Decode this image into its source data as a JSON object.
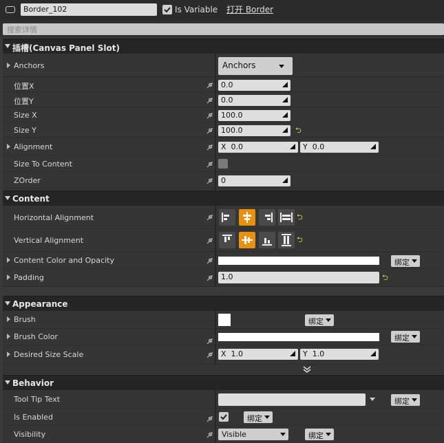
{
  "header": {
    "widget_name": "Border_102",
    "is_variable_label": "Is Variable",
    "is_variable_checked": true,
    "open_link": "打开 Border"
  },
  "search": {
    "placeholder": "搜索详情"
  },
  "sections": {
    "slot": "插槽(Canvas Panel Slot)",
    "content": "Content",
    "appearance": "Appearance",
    "behavior": "Behavior"
  },
  "slot": {
    "anchors_label": "Anchors",
    "anchors_value": "Anchors",
    "pos_x_label": "位置X",
    "pos_x_value": "0.0",
    "pos_y_label": "位置Y",
    "pos_y_value": "0.0",
    "size_x_label": "Size X",
    "size_x_value": "100.0",
    "size_y_label": "Size Y",
    "size_y_value": "100.0",
    "alignment_label": "Alignment",
    "alignment_x_prefix": "X",
    "alignment_x": "0.0",
    "alignment_y_prefix": "Y",
    "alignment_y": "0.0",
    "size_to_content_label": "Size To Content",
    "size_to_content_checked": false,
    "zorder_label": "ZOrder",
    "zorder_value": "0"
  },
  "content": {
    "h_align_label": "Horizontal Alignment",
    "h_align_selected": "center",
    "v_align_label": "Vertical Alignment",
    "v_align_selected": "center",
    "color_label": "Content Color and Opacity",
    "color_value": "#ffffff",
    "bind_label": "绑定",
    "padding_label": "Padding",
    "padding_value": "1.0"
  },
  "appearance": {
    "brush_label": "Brush",
    "brush_bind": "绑定",
    "brush_color_label": "Brush Color",
    "brush_color_value": "#ffffff",
    "brush_color_bind": "绑定",
    "desired_label": "Desired Size Scale",
    "desired_x_prefix": "X",
    "desired_x": "1.0",
    "desired_y_prefix": "Y",
    "desired_y": "1.0"
  },
  "behavior": {
    "tooltip_label": "Tool Tip Text",
    "tooltip_value": "",
    "tooltip_bind": "绑定",
    "enabled_label": "Is Enabled",
    "enabled_checked": true,
    "enabled_bind": "绑定",
    "visibility_label": "Visibility",
    "visibility_value": "Visible",
    "visibility_bind": "绑定"
  },
  "colors": {
    "accent": "#e8900f",
    "reset_arrow": "#e6d84b",
    "panel_bg": "#353535",
    "section_bg": "#252525"
  }
}
